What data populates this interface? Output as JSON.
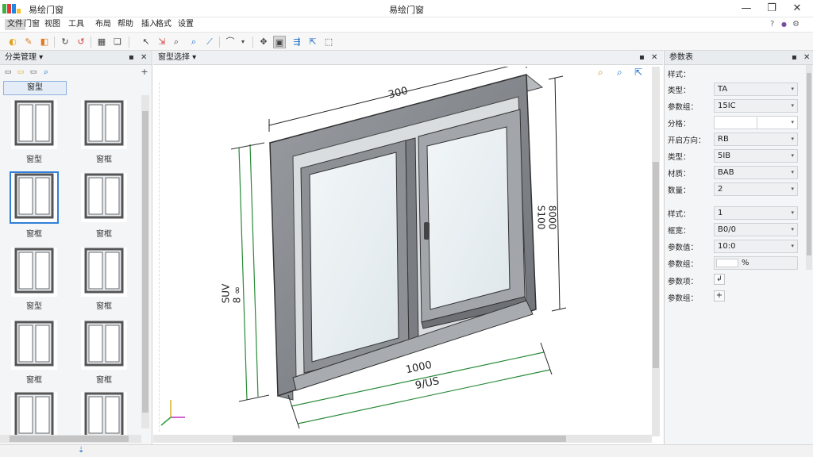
{
  "app": {
    "title": "易绘门窗",
    "logo_colors": [
      "#3cb043",
      "#e53935",
      "#1e88e5",
      "#fbc02d"
    ]
  },
  "window_controls": {
    "minimize": "—",
    "maximize": "❐",
    "close": "✕"
  },
  "menu": [
    "文件",
    "门窗",
    "视图",
    "工具",
    "布局",
    "帮助",
    "插入",
    "格式",
    "设置"
  ],
  "ribbon_right": {
    "help": "?",
    "dot": "●",
    "settings": "⚙"
  },
  "left_panel": {
    "title": "分类管理 ▾",
    "category_button": "窗型",
    "items": [
      {
        "label": "窗型"
      },
      {
        "label": "窗框"
      },
      {
        "label": "窗框"
      },
      {
        "label": "窗框"
      },
      {
        "label": "窗型"
      },
      {
        "label": "窗框"
      },
      {
        "label": "窗框"
      },
      {
        "label": "窗框"
      },
      {
        "label": ""
      },
      {
        "label": ""
      }
    ]
  },
  "center_panel": {
    "title": "窗型选择 ▾",
    "dims": {
      "top": "300",
      "left": "SUV\n8 ∞",
      "right": "8000\nЅ100",
      "bottom1": "1000",
      "bottom2": "9/US"
    }
  },
  "right_panel": {
    "title": "参数表",
    "section": "样式：",
    "rows": [
      {
        "label": "类型：",
        "value": "TA",
        "type": "select"
      },
      {
        "label": "参数组：",
        "value": "15IC",
        "type": "select"
      },
      {
        "label": "分格：",
        "value": "",
        "type": "split"
      },
      {
        "label": "开启方向：",
        "value": "RB",
        "type": "select"
      },
      {
        "label": "类型：",
        "value": "5IB",
        "type": "select"
      },
      {
        "label": "材质：",
        "value": "BAB",
        "type": "select"
      },
      {
        "label": "数量：",
        "value": "2",
        "type": "select"
      },
      {
        "label": "样式：",
        "value": "1",
        "type": "select"
      },
      {
        "label": "框宽：",
        "value": "B0/0",
        "type": "select"
      },
      {
        "label": "参数值：",
        "value": "10:0",
        "type": "select"
      },
      {
        "label": "参数组：",
        "value": "",
        "type": "color",
        "suffix": "%"
      },
      {
        "label": "参数项：",
        "value": "↲",
        "type": "button"
      },
      {
        "label": "参数组：",
        "value": "+",
        "type": "button"
      }
    ]
  },
  "statusbar": {
    "text": "⇣"
  }
}
